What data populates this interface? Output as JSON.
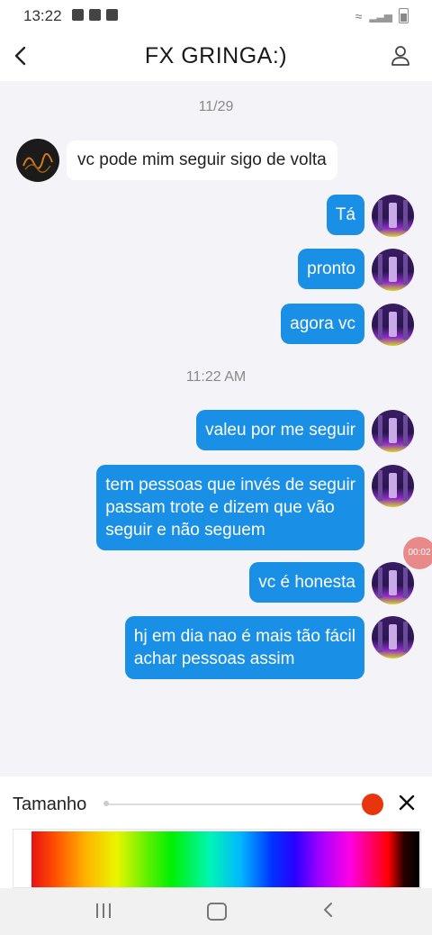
{
  "status_bar": {
    "time": "13:22"
  },
  "header": {
    "title": "FX GRINGA:)"
  },
  "chat": {
    "date_1": "11/29",
    "incoming_text": "vc pode mim seguir sigo de volta",
    "msg_1": "Tá",
    "msg_2": "pronto",
    "msg_3": "agora vc",
    "time_2": "11:22 AM",
    "msg_4": "valeu por me seguir",
    "msg_5_lines": [
      "tem pessoas que invés de seguir",
      "passam trote e dizem que vão",
      "seguir e não seguem"
    ],
    "msg_6": "vc é honesta",
    "msg_7_lines": [
      "hj em dia nao é mais tão fácil",
      "achar pessoas assim"
    ]
  },
  "recording_indicator": {
    "label": "00:02"
  },
  "brush_panel": {
    "size_label": "Tamanho",
    "size_value": 1.0,
    "selected_color": "#e8350d"
  },
  "colors": {
    "accent_blue": "#1a8fe6",
    "background": "#f4f3f8"
  },
  "icons": {
    "back": "chevron-left-icon",
    "profile": "person-icon",
    "close": "close-icon",
    "nav_recent": "recent-apps-icon",
    "nav_home": "home-icon",
    "nav_back": "back-icon"
  }
}
